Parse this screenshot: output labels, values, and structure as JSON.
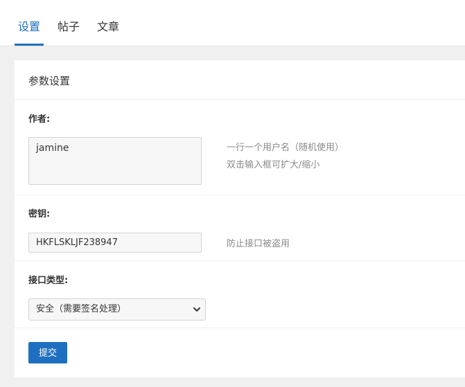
{
  "tabs": [
    {
      "label": "设置",
      "active": true
    },
    {
      "label": "帖子",
      "active": false
    },
    {
      "label": "文章",
      "active": false
    }
  ],
  "card": {
    "title": "参数设置"
  },
  "fields": {
    "author": {
      "label": "作者:",
      "value": "jamine",
      "hints": [
        "一行一个用户名（随机使用）",
        "双击输入框可扩大/缩小"
      ]
    },
    "secret": {
      "label": "密钥:",
      "value": "HKFLSKLJF238947",
      "hint": "防止接口被盗用"
    },
    "api_type": {
      "label": "接口类型:",
      "selected": "安全（需要签名处理）"
    }
  },
  "submit_label": "提交",
  "colors": {
    "accent": "#1e6fbf",
    "hint": "#8a8a8a",
    "background": "#f0f0f0"
  }
}
